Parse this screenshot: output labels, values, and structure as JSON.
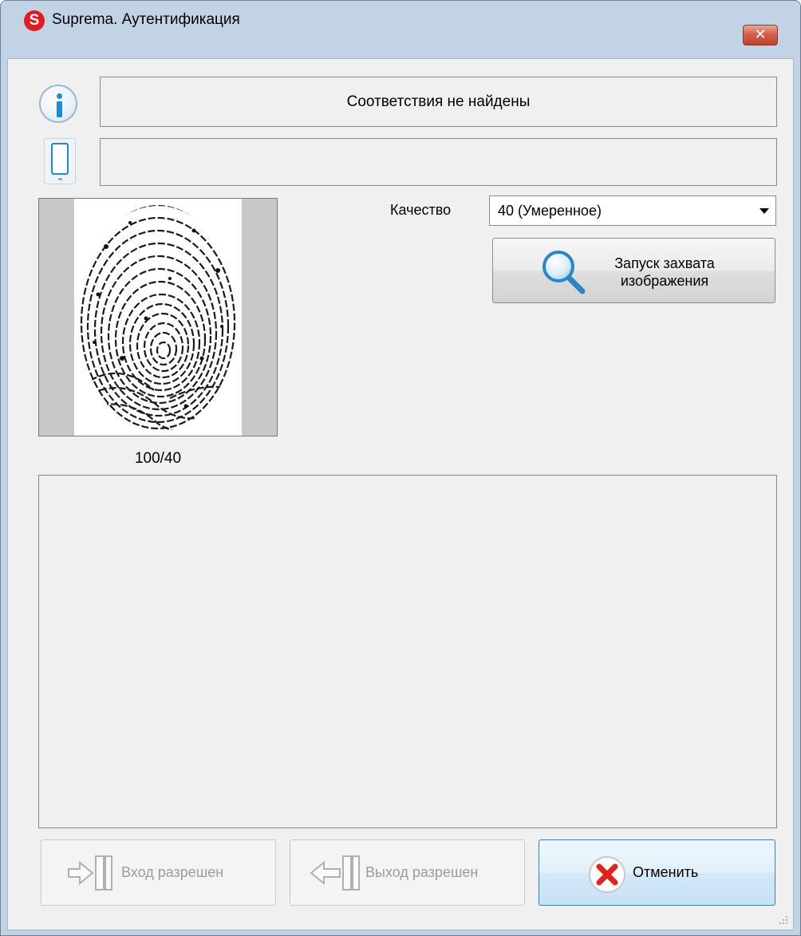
{
  "window": {
    "title": "Suprema. Аутентификация",
    "app_icon_letter": "S",
    "close_glyph": "✕",
    "accent_color": "#e11b22"
  },
  "status": {
    "message": "Соответствия не найдены",
    "device_message": ""
  },
  "fingerprint": {
    "quality_score": "100/40"
  },
  "quality": {
    "label": "Качество",
    "selected": "40 (Умеренное)"
  },
  "capture": {
    "label": "Запуск захвата\nизображения",
    "icon": "magnifier-icon"
  },
  "log": {
    "text": ""
  },
  "buttons": {
    "entry_label": "Вход разрешен",
    "exit_label": "Выход разрешен",
    "cancel_label": "Отменить",
    "entry_enabled": false,
    "exit_enabled": false
  }
}
